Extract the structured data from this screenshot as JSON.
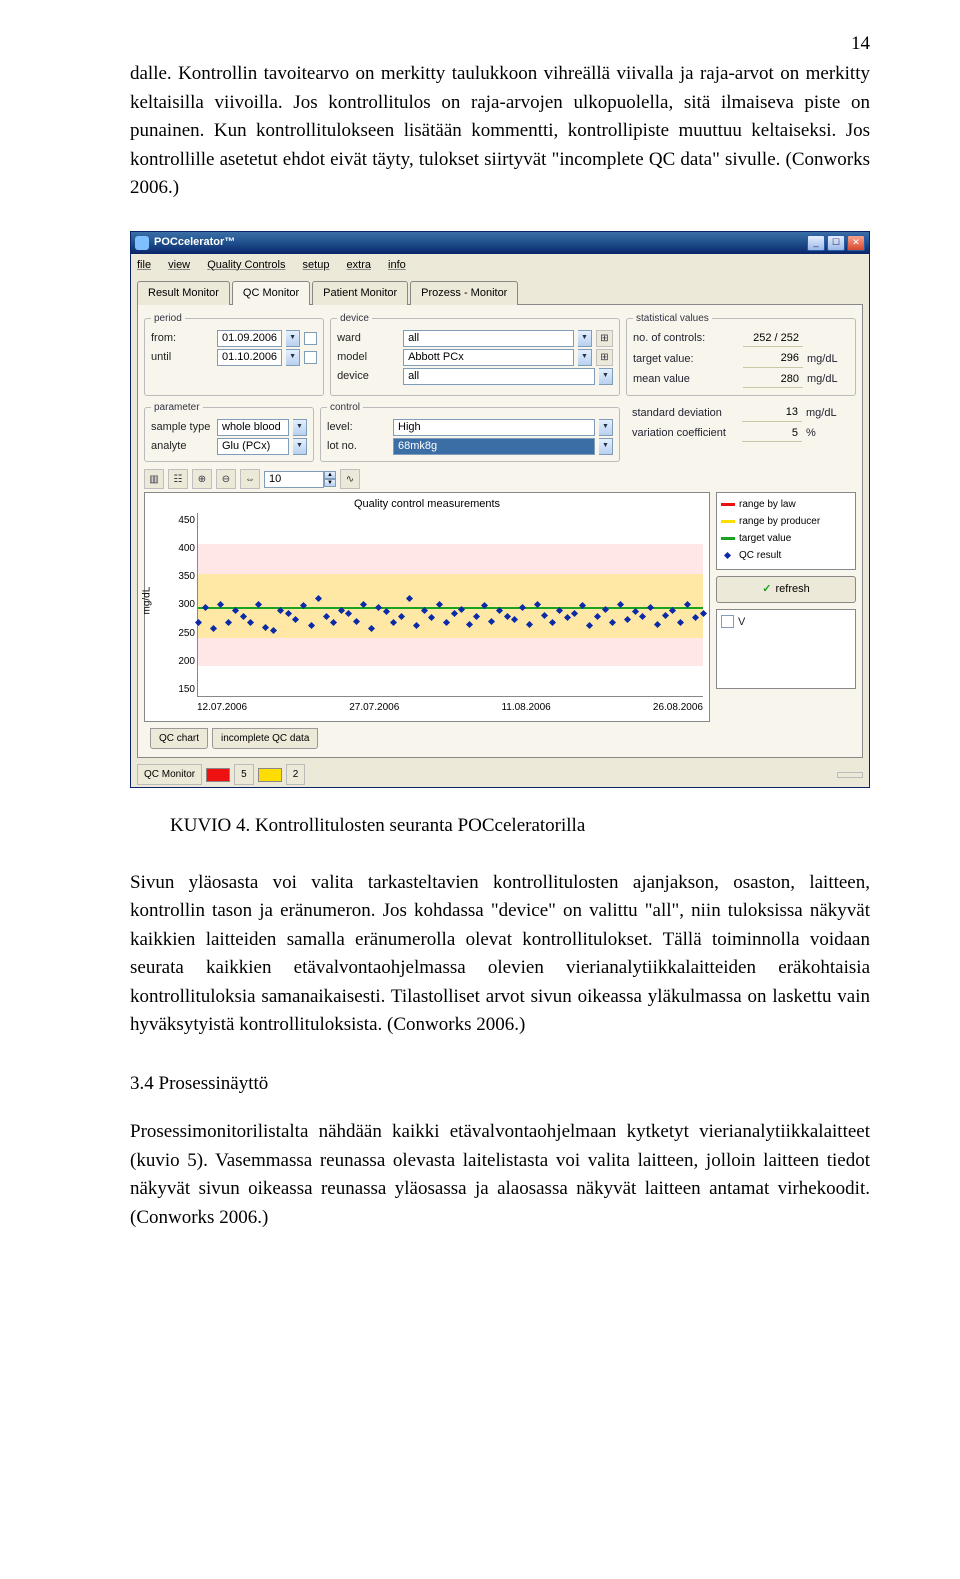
{
  "page_number": "14",
  "para1": "dalle. Kontrollin tavoitearvo on merkitty taulukkoon vihreällä viivalla ja raja-arvot on merkitty keltaisilla viivoilla. Jos kontrollitulos on raja-arvojen ulkopuolella, sitä ilmaiseva piste on punainen. Kun kontrollitulokseen lisätään kommentti, kontrollipiste muuttuu keltaiseksi. Jos kontrollille asetetut ehdot eivät täyty, tulokset siirtyvät \"incomplete QC data\" sivulle. (Conworks 2006.)",
  "caption": "KUVIO 4. Kontrollitulosten seuranta POCceleratorilla",
  "para2": "Sivun yläosasta voi valita tarkasteltavien kontrollitulosten ajanjakson, osaston, laitteen, kontrollin tason ja eränumeron. Jos kohdassa \"device\" on valittu \"all\", niin tuloksissa näkyvät kaikkien laitteiden samalla eränumerolla olevat kontrollitulokset. Tällä toiminnolla voidaan seurata kaikkien etävalvontaohjelmassa olevien vierianalytiikkalaitteiden eräkohtaisia kontrollituloksia samanaikaisesti. Tilastolliset arvot sivun oikeassa yläkulmassa on laskettu vain hyväksytyistä kontrollituloksista. (Conworks 2006.)",
  "heading": "3.4 Prosessinäyttö",
  "para3": "Prosessimonitorilistalta nähdään kaikki etävalvontaohjelmaan kytketyt vierianalytiikkalaitteet (kuvio 5). Vasemmassa reunassa olevasta laitelistasta voi valita laitteen, jolloin laitteen tiedot näkyvät sivun oikeassa reunassa yläosassa ja alaosassa näkyvät laitteen antamat virhekoodit. (Conworks 2006.)",
  "app": {
    "title": "POCcelerator™",
    "menu": [
      "file",
      "view",
      "Quality Controls",
      "setup",
      "extra",
      "info"
    ],
    "tabs": [
      "Result Monitor",
      "QC Monitor",
      "Patient Monitor",
      "Prozess - Monitor"
    ],
    "active_tab": "QC Monitor",
    "period": {
      "legend": "period",
      "from_lbl": "from:",
      "from": "01.09.2006",
      "until_lbl": "until",
      "until": "01.10.2006"
    },
    "device": {
      "legend": "device",
      "ward_lbl": "ward",
      "ward": "all",
      "model_lbl": "model",
      "model": "Abbott PCx",
      "device_lbl": "device",
      "device": "all"
    },
    "stats": {
      "legend": "statistical values",
      "no_lbl": "no. of controls:",
      "no": "252 / 252",
      "target_lbl": "target value:",
      "target": "296",
      "mean_lbl": "mean value",
      "mean": "280",
      "sd_lbl": "standard deviation",
      "sd": "13",
      "cv_lbl": "variation coefficient",
      "cv": "5",
      "unit_mgdl": "mg/dL",
      "unit_pct": "%"
    },
    "parameter": {
      "legend": "parameter",
      "sample_lbl": "sample type",
      "sample": "whole blood",
      "analyte_lbl": "analyte",
      "analyte": "Glu (PCx)"
    },
    "control": {
      "legend": "control",
      "level_lbl": "level:",
      "level": "High",
      "lot_lbl": "lot no.",
      "lot": "68mk8g"
    },
    "toolbar": {
      "spin": "10"
    },
    "chart_data": {
      "type": "scatter",
      "title": "Quality control measurements",
      "ylabel": "mg/dL",
      "ylim": [
        150,
        450
      ],
      "yticks": [
        "450",
        "400",
        "350",
        "300",
        "250",
        "200",
        "150"
      ],
      "xticks": [
        "12.07.2006",
        "27.07.2006",
        "11.08.2006",
        "26.08.2006"
      ],
      "target": 296,
      "band_by_law": [
        200,
        400
      ],
      "band_by_producer": [
        245,
        350
      ],
      "values": [
        270,
        295,
        260,
        300,
        270,
        290,
        280,
        270,
        300,
        262,
        258,
        290,
        285,
        275,
        298,
        265,
        310,
        280,
        270,
        290,
        285,
        272,
        300,
        260,
        295,
        288,
        270,
        280,
        310,
        265,
        290,
        278,
        300,
        270,
        285,
        292,
        268,
        280,
        298,
        272,
        290,
        280,
        275,
        295,
        268,
        300,
        282,
        270,
        290,
        278,
        285,
        298,
        265,
        280,
        292,
        270,
        300,
        275,
        288,
        280,
        295,
        268,
        282,
        290,
        270,
        300,
        278,
        285
      ]
    },
    "legend": {
      "law": "range by law",
      "prod": "range by producer",
      "target": "target value",
      "qc": "QC result"
    },
    "refresh": "refresh",
    "v_label": "V",
    "bottom_tabs": [
      "QC chart",
      "incomplete QC data"
    ],
    "status": {
      "label": "QC Monitor",
      "red": "5",
      "yellow": "2"
    }
  }
}
